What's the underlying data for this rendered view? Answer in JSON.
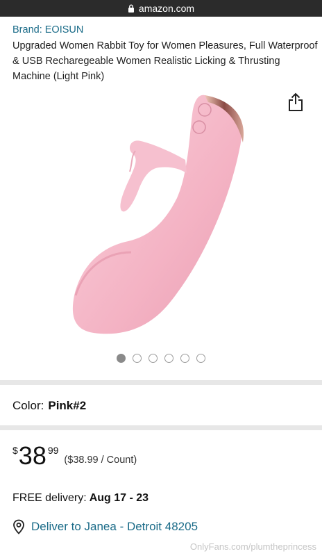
{
  "browser": {
    "url": "amazon.com"
  },
  "product": {
    "brand": "Brand: EOISUN",
    "title": "Upgraded Women Rabbit Toy for Women Pleasures, Full Waterproof & USB Recharegeable Women Realistic Licking & Thrusting Machine (Light Pink)",
    "image_count": 6,
    "active_image_index": 0
  },
  "color": {
    "label": "Color:",
    "value": "Pink#2"
  },
  "price": {
    "currency": "$",
    "whole": "38",
    "fraction": "99",
    "per_unit": "($38.99 / Count)"
  },
  "delivery": {
    "label": "FREE delivery:",
    "date": "Aug 17 - 23"
  },
  "location": {
    "text": "Deliver to Janea - Detroit 48205"
  },
  "watermark": "OnlyFans.com/plumtheprincess",
  "icons": [
    "lock-icon",
    "share-icon",
    "location-pin-icon"
  ],
  "colors": {
    "link": "#1a6b88",
    "product_pink": "#f4b5c6",
    "separator": "#e7e7e7"
  }
}
